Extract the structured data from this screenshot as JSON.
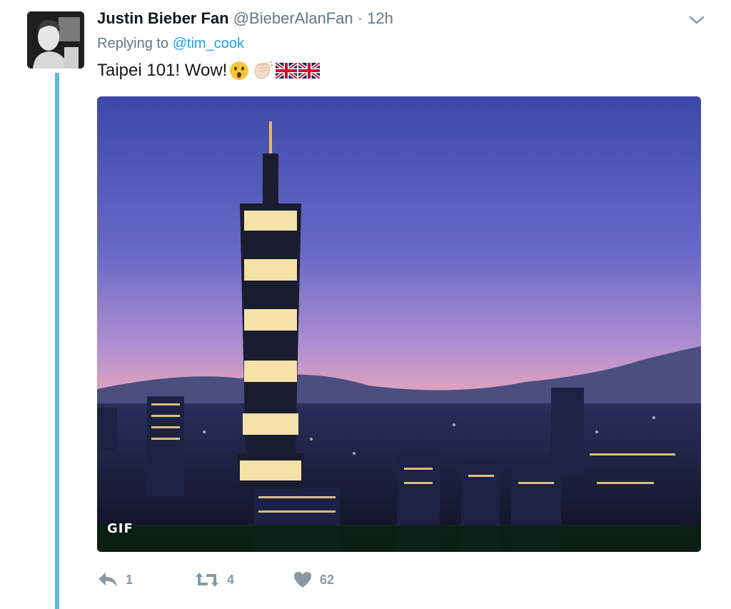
{
  "tweet": {
    "display_name": "Justin Bieber Fan",
    "handle": "@BieberAlanFan",
    "separator": "·",
    "time": "12h",
    "reply_prefix": "Replying to ",
    "reply_to": "@tim_cook",
    "text": "Taipei 101! Wow!",
    "emojis": [
      "astonished-face",
      "clapping-hands",
      "uk-flag",
      "uk-flag"
    ]
  },
  "media": {
    "type": "gif",
    "badge": "GIF",
    "subject": "Taipei 101 skyline at dusk"
  },
  "actions": {
    "reply_count": "1",
    "retweet_count": "4",
    "like_count": "62"
  },
  "colors": {
    "thread_line": "#5cb8d4",
    "link": "#1da1f2",
    "muted": "#657786",
    "action_icon": "#8899a6"
  },
  "icons": [
    "chevron-down-icon",
    "reply-icon",
    "retweet-icon",
    "heart-icon"
  ]
}
